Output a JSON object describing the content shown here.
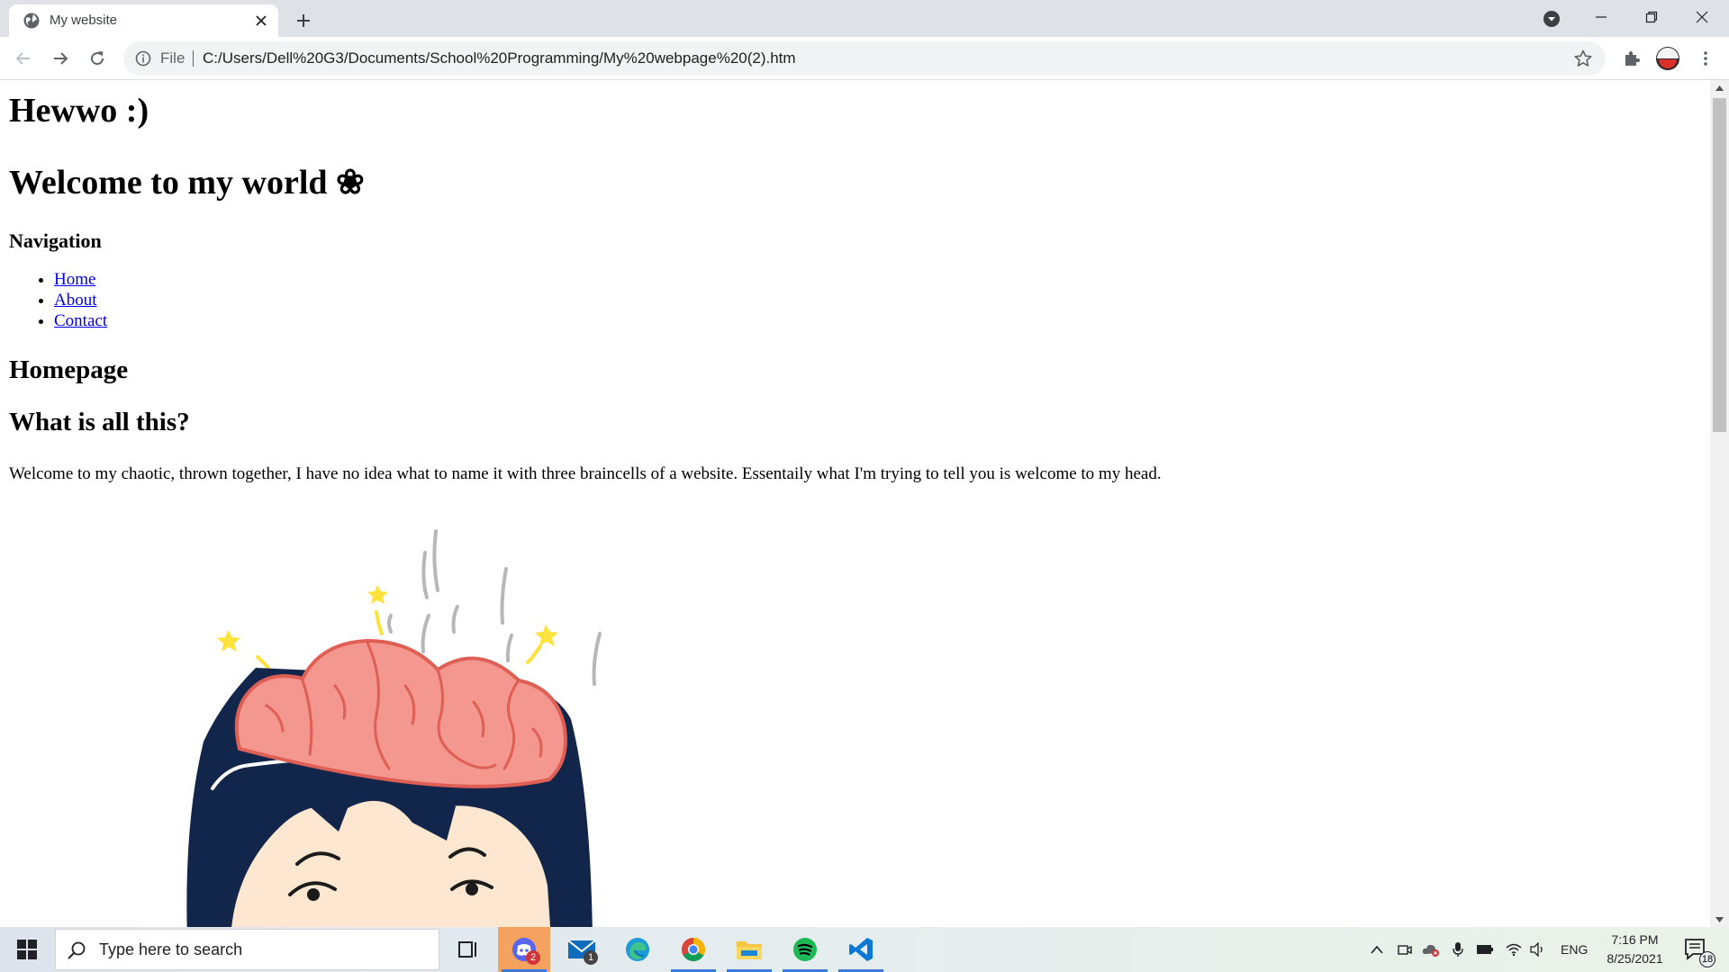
{
  "browser": {
    "tab_title": "My website",
    "address_scheme": "File",
    "address_url": "C:/Users/Dell%20G3/Documents/School%20Programming/My%20webpage%20(2).htm"
  },
  "page": {
    "heading_greeting": "Hewwo :)",
    "heading_welcome": "Welcome to my world ❀",
    "nav_heading": "Navigation",
    "nav_links": [
      "Home",
      "About",
      "Contact"
    ],
    "section_homepage": "Homepage",
    "section_question": "What is all this?",
    "intro_paragraph": "Welcome to my chaotic, thrown together, I have no idea what to name it with three braincells of a website. Essentaily what I'm trying to tell you is welcome to my head."
  },
  "taskbar": {
    "search_placeholder": "Type here to search",
    "apps": [
      {
        "name": "discord",
        "badge": "2"
      },
      {
        "name": "mail",
        "badge": "1"
      },
      {
        "name": "edge",
        "badge": ""
      },
      {
        "name": "chrome",
        "badge": ""
      },
      {
        "name": "file-explorer",
        "badge": ""
      },
      {
        "name": "spotify",
        "badge": ""
      },
      {
        "name": "vscode",
        "badge": ""
      }
    ],
    "language": "ENG",
    "time": "7:16 PM",
    "date": "8/25/2021",
    "notification_count": "18"
  },
  "colors": {
    "tabstrip_bg": "#dee1e6",
    "link": "#0000ee",
    "brain": "#f4978e",
    "hair": "#12254a"
  }
}
